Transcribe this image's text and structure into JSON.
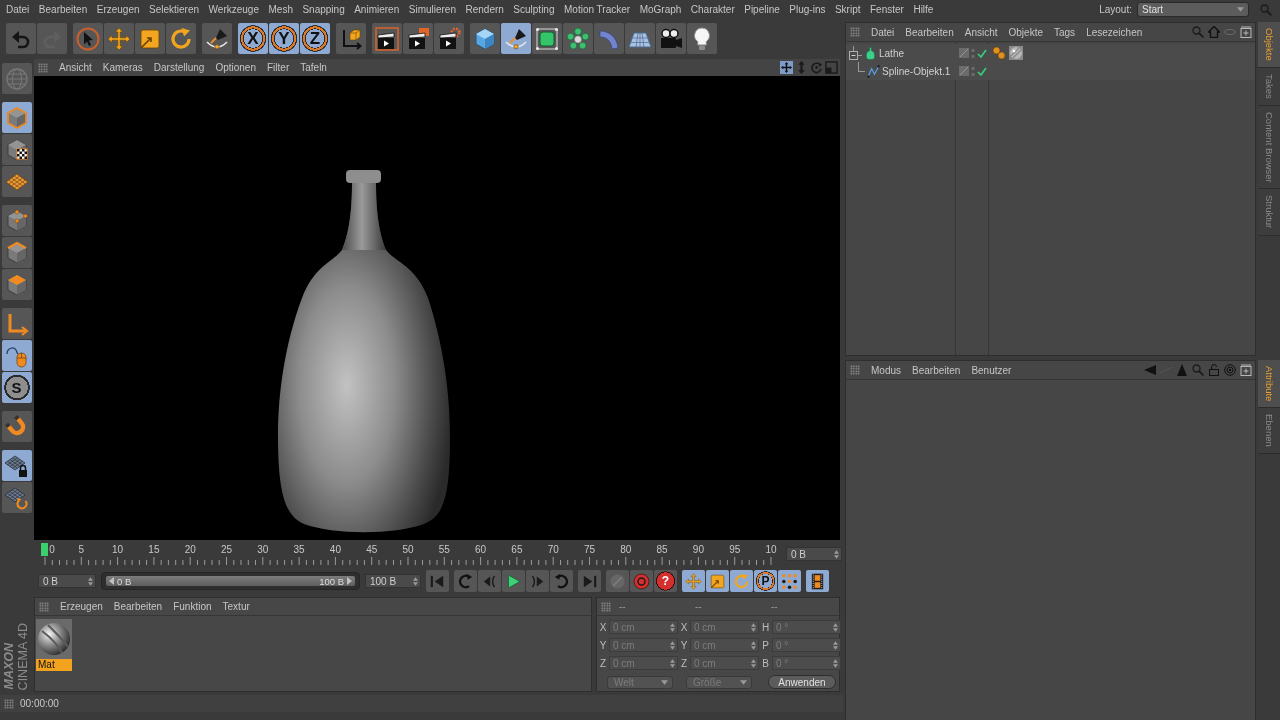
{
  "menu_bar": {
    "items": [
      "Datei",
      "Bearbeiten",
      "Erzeugen",
      "Selektieren",
      "Werkzeuge",
      "Mesh",
      "Snapping",
      "Animieren",
      "Simulieren",
      "Rendern",
      "Sculpting",
      "Motion Tracker",
      "MoGraph",
      "Charakter",
      "Pipeline",
      "Plug-ins",
      "Skript",
      "Fenster",
      "Hilfe"
    ],
    "layout_label": "Layout:",
    "layout_value": "Start"
  },
  "toolbar": {
    "groups": [
      [
        {
          "kind": "undo",
          "selected": false,
          "disabled": false
        },
        {
          "kind": "redo",
          "selected": false,
          "disabled": true
        }
      ],
      [
        {
          "kind": "select",
          "selected": false,
          "disabled": false
        },
        {
          "kind": "move",
          "selected": false,
          "disabled": false
        },
        {
          "kind": "scale",
          "selected": false,
          "disabled": false
        },
        {
          "kind": "rotate",
          "selected": false,
          "disabled": false
        }
      ],
      [
        {
          "kind": "pen",
          "selected": false,
          "disabled": false
        }
      ],
      [
        {
          "kind": "axis",
          "label": "X",
          "selected": true,
          "disabled": false
        },
        {
          "kind": "axis",
          "label": "Y",
          "selected": true,
          "disabled": false
        },
        {
          "kind": "axis",
          "label": "Z",
          "selected": true,
          "disabled": false
        }
      ],
      [
        {
          "kind": "coords",
          "selected": false,
          "disabled": false
        }
      ],
      [
        {
          "kind": "render-view",
          "selected": false,
          "disabled": false
        },
        {
          "kind": "render-picture",
          "selected": false,
          "disabled": false
        },
        {
          "kind": "render-settings",
          "selected": false,
          "disabled": false
        }
      ],
      [
        {
          "kind": "cube",
          "selected": false,
          "disabled": false
        },
        {
          "kind": "spline-pen",
          "selected": true,
          "disabled": false
        },
        {
          "kind": "subdivision",
          "selected": false,
          "disabled": false
        },
        {
          "kind": "cloner",
          "selected": false,
          "disabled": false
        },
        {
          "kind": "bend",
          "selected": false,
          "disabled": false
        },
        {
          "kind": "floor",
          "selected": false,
          "disabled": false
        },
        {
          "kind": "camera",
          "selected": false,
          "disabled": false
        },
        {
          "kind": "light",
          "selected": false,
          "disabled": false
        }
      ]
    ]
  },
  "left_toolbar": {
    "groups": [
      [
        {
          "kind": "editable",
          "selected": false,
          "disabled": true
        }
      ],
      [
        {
          "kind": "model",
          "selected": true,
          "disabled": false
        },
        {
          "kind": "texture",
          "selected": false,
          "disabled": false
        },
        {
          "kind": "workplane",
          "selected": false,
          "disabled": false
        }
      ],
      [
        {
          "kind": "points",
          "selected": false,
          "disabled": false
        },
        {
          "kind": "edges",
          "selected": false,
          "disabled": false
        },
        {
          "kind": "polygons",
          "selected": false,
          "disabled": false
        }
      ],
      [
        {
          "kind": "axis-mode",
          "selected": false,
          "disabled": false
        },
        {
          "kind": "tweak",
          "selected": true,
          "disabled": false
        },
        {
          "kind": "snap",
          "label": "S",
          "selected": true,
          "disabled": false
        }
      ],
      [
        {
          "kind": "magnet",
          "selected": false,
          "disabled": false
        }
      ],
      [
        {
          "kind": "workplane-lock",
          "selected": true,
          "disabled": false
        },
        {
          "kind": "workplane-rotate",
          "selected": false,
          "disabled": false
        }
      ]
    ]
  },
  "viewport": {
    "menu": [
      "Ansicht",
      "Kameras",
      "Darstellung",
      "Optionen",
      "Filter",
      "Tafeln"
    ]
  },
  "timeline": {
    "frame_labels": [
      "0",
      "5",
      "10",
      "15",
      "20",
      "25",
      "30",
      "35",
      "40",
      "45",
      "50",
      "55",
      "60",
      "65",
      "70",
      "75",
      "80",
      "85",
      "90",
      "95",
      "10"
    ],
    "level": 0,
    "current_frame": "0 B"
  },
  "transport": {
    "start": "0 B",
    "range": {
      "start_label": "0 B",
      "end_label": "100 B",
      "level": 1
    },
    "end": "100 B",
    "groups": [
      [
        {
          "kind": "first",
          "selected": false,
          "disabled": false
        }
      ],
      [
        {
          "kind": "prev-key",
          "selected": false,
          "disabled": false
        },
        {
          "kind": "prev",
          "selected": false,
          "disabled": false
        },
        {
          "kind": "play",
          "selected": false,
          "disabled": false
        },
        {
          "kind": "next",
          "selected": false,
          "disabled": false
        },
        {
          "kind": "next-key",
          "selected": false,
          "disabled": false
        }
      ],
      [
        {
          "kind": "last",
          "selected": false,
          "disabled": false
        }
      ],
      [
        {
          "kind": "record",
          "selected": false,
          "disabled": true
        },
        {
          "kind": "autokey",
          "selected": false,
          "disabled": false
        },
        {
          "kind": "keyframe",
          "label": "?",
          "selected": false,
          "disabled": false
        }
      ],
      [
        {
          "kind": "key-move",
          "selected": true,
          "disabled": false
        },
        {
          "kind": "key-scale",
          "selected": true,
          "disabled": false
        },
        {
          "kind": "key-rotate",
          "selected": true,
          "disabled": false
        },
        {
          "kind": "key-param",
          "label": "P",
          "selected": true,
          "disabled": false
        },
        {
          "kind": "key-pla",
          "selected": true,
          "disabled": false
        }
      ],
      [
        {
          "kind": "timeline",
          "selected": true,
          "disabled": false
        }
      ]
    ]
  },
  "logo": {
    "brand": "MAXON",
    "product": "CINEMA 4D"
  },
  "material_manager": {
    "menu": [
      "Erzeugen",
      "Bearbeiten",
      "Funktion",
      "Textur"
    ],
    "materials": [
      {
        "name": "Mat",
        "selected": true
      }
    ]
  },
  "coordinates": {
    "disabled": true,
    "headers": [
      "--",
      "--",
      "--"
    ],
    "rows": [
      {
        "pos_axis": "X",
        "pos": "0 cm",
        "size_axis": "X",
        "size": "0 cm",
        "rot_axis": "H",
        "rot": "0 °"
      },
      {
        "pos_axis": "Y",
        "pos": "0 cm",
        "size_axis": "Y",
        "size": "0 cm",
        "rot_axis": "P",
        "rot": "0 °"
      },
      {
        "pos_axis": "Z",
        "pos": "0 cm",
        "size_axis": "Z",
        "size": "0 cm",
        "rot_axis": "B",
        "rot": "0 °"
      }
    ],
    "dropdowns": [
      "Welt",
      "Größe"
    ],
    "apply": "Anwenden"
  },
  "status_bar": {
    "text": "00:00:00"
  },
  "object_manager": {
    "menu": [
      "Datei",
      "Bearbeiten",
      "Ansicht",
      "Objekte",
      "Tags",
      "Lesezeichen"
    ],
    "objects": [
      {
        "name": "Lathe",
        "kind": "lathe",
        "expanded": true,
        "enabled": true,
        "tags": [
          {
            "kind": "phong"
          },
          {
            "kind": "material"
          }
        ],
        "children": [
          {
            "name": "Spline-Objekt.1",
            "kind": "spline",
            "enabled": true
          }
        ]
      }
    ]
  },
  "attribute_manager": {
    "menu": [
      "Modus",
      "Bearbeiten",
      "Benutzer"
    ]
  },
  "side_tabs": {
    "upper": [
      {
        "label": "Objekte",
        "selected": true
      },
      {
        "label": "Takes",
        "selected": false
      },
      {
        "label": "Content Browser",
        "selected": false
      },
      {
        "label": "Struktur",
        "selected": false
      }
    ],
    "lower": [
      {
        "label": "Attribute",
        "selected": true
      },
      {
        "label": "Ebenen",
        "selected": false
      }
    ]
  }
}
